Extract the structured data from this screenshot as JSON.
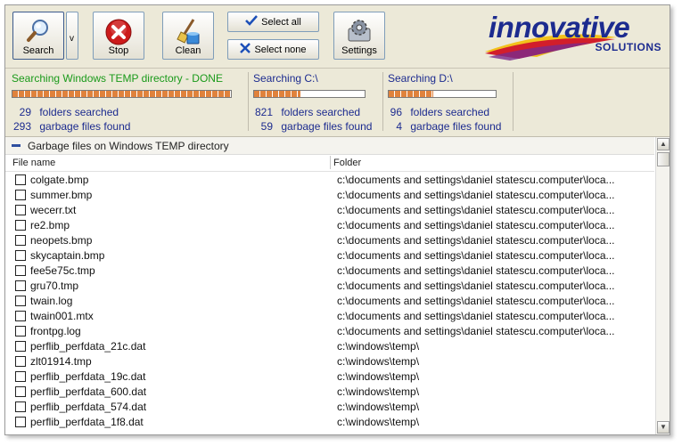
{
  "toolbar": {
    "search_label": "Search",
    "dropdown_label": "v",
    "stop_label": "Stop",
    "clean_label": "Clean",
    "select_all_label": "Select all",
    "select_none_label": "Select none",
    "settings_label": "Settings"
  },
  "logo": {
    "main": "innovative",
    "sub": "SOLUTIONS",
    "colors": {
      "text": "#1c2b8f",
      "swoosh_red": "#d21e2b",
      "swoosh_yellow": "#f2c21b",
      "swoosh_purple": "#7a2a8c"
    }
  },
  "status": {
    "temp": {
      "title": "Searching Windows TEMP directory - DONE",
      "progress": 1.0,
      "folders_count": "29",
      "folders_label": "folders searched",
      "garbage_count": "293",
      "garbage_label": "garbage files found",
      "title_color": "#1a9a1a"
    },
    "c": {
      "title": "Searching C:\\",
      "progress": 0.42,
      "folders_count": "821",
      "folders_label": "folders searched",
      "garbage_count": "59",
      "garbage_label": "garbage files found"
    },
    "d": {
      "title": "Searching D:\\",
      "progress": 0.42,
      "folders_count": "96",
      "folders_label": "folders searched",
      "garbage_count": "4",
      "garbage_label": "garbage files found"
    }
  },
  "list": {
    "group_title": "Garbage files on Windows TEMP directory",
    "col_file": "File name",
    "col_folder": "Folder",
    "rows": [
      {
        "file": "colgate.bmp",
        "folder": "c:\\documents and settings\\daniel statescu.computer\\loca..."
      },
      {
        "file": "summer.bmp",
        "folder": "c:\\documents and settings\\daniel statescu.computer\\loca..."
      },
      {
        "file": "wecerr.txt",
        "folder": "c:\\documents and settings\\daniel statescu.computer\\loca..."
      },
      {
        "file": "re2.bmp",
        "folder": "c:\\documents and settings\\daniel statescu.computer\\loca..."
      },
      {
        "file": "neopets.bmp",
        "folder": "c:\\documents and settings\\daniel statescu.computer\\loca..."
      },
      {
        "file": "skycaptain.bmp",
        "folder": "c:\\documents and settings\\daniel statescu.computer\\loca..."
      },
      {
        "file": "fee5e75c.tmp",
        "folder": "c:\\documents and settings\\daniel statescu.computer\\loca..."
      },
      {
        "file": "gru70.tmp",
        "folder": "c:\\documents and settings\\daniel statescu.computer\\loca..."
      },
      {
        "file": "twain.log",
        "folder": "c:\\documents and settings\\daniel statescu.computer\\loca..."
      },
      {
        "file": "twain001.mtx",
        "folder": "c:\\documents and settings\\daniel statescu.computer\\loca..."
      },
      {
        "file": "frontpg.log",
        "folder": "c:\\documents and settings\\daniel statescu.computer\\loca..."
      },
      {
        "file": "perflib_perfdata_21c.dat",
        "folder": "c:\\windows\\temp\\"
      },
      {
        "file": "zlt01914.tmp",
        "folder": "c:\\windows\\temp\\"
      },
      {
        "file": "perflib_perfdata_19c.dat",
        "folder": "c:\\windows\\temp\\"
      },
      {
        "file": "perflib_perfdata_600.dat",
        "folder": "c:\\windows\\temp\\"
      },
      {
        "file": "perflib_perfdata_574.dat",
        "folder": "c:\\windows\\temp\\"
      },
      {
        "file": "perflib_perfdata_1f8.dat",
        "folder": "c:\\windows\\temp\\"
      }
    ]
  },
  "icons": {
    "search": "magnifier-icon",
    "stop": "stop-x-icon",
    "clean": "broom-bucket-icon",
    "select_all": "checkmark-icon",
    "select_none": "x-icon",
    "settings": "gear-icon",
    "group_toggle": "collapse-minus-icon"
  }
}
